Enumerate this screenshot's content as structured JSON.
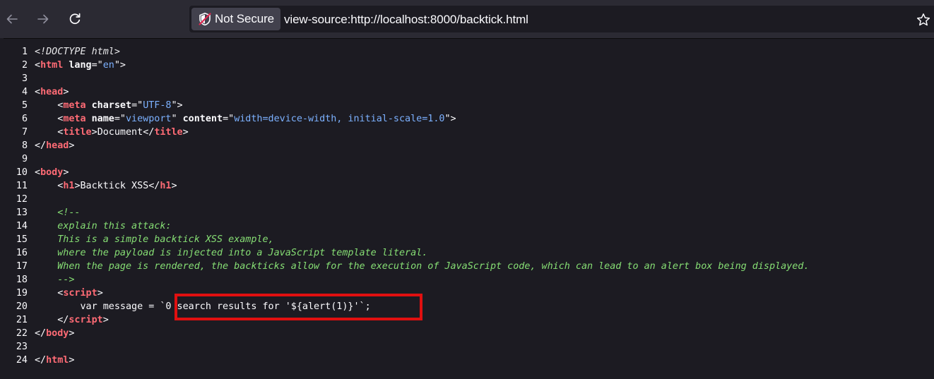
{
  "browser": {
    "security_label": "Not Secure",
    "url": "view-source:http://localhost:8000/backtick.html"
  },
  "icons": {
    "back": "back-arrow-icon",
    "forward": "forward-arrow-icon",
    "reload": "reload-icon",
    "security": "shield-warning-icon",
    "bookmark": "star-icon"
  },
  "colors": {
    "tag": "#ff6b75",
    "attribute_value": "#7cb1ff",
    "comment": "#86de74",
    "highlight_box": "#e01010"
  },
  "source": {
    "line_numbers": [
      "1",
      "2",
      "3",
      "4",
      "5",
      "6",
      "7",
      "8",
      "9",
      "10",
      "11",
      "12",
      "13",
      "14",
      "15",
      "16",
      "17",
      "18",
      "19",
      "20",
      "21",
      "22",
      "23",
      "24"
    ],
    "l1": "<!DOCTYPE html>",
    "l2": {
      "lt": "<",
      "tag": "html",
      "attr": "lang",
      "eq": "=\"",
      "val": "en",
      "end": "\">"
    },
    "l4": {
      "lt": "<",
      "tag": "head",
      "gt": ">"
    },
    "l5": {
      "lt": "<",
      "tag": "meta",
      "attr": "charset",
      "eq": "=\"",
      "val": "UTF-8",
      "end": "\">"
    },
    "l6": {
      "lt": "<",
      "tag": "meta",
      "attr1": "name",
      "eq1": "=\"",
      "val1": "viewport",
      "q1": "\" ",
      "attr2": "content",
      "eq2": "=\"",
      "val2": "width=device-width, initial-scale=1.0",
      "end": "\">"
    },
    "l7": {
      "lt": "<",
      "tag": "title",
      "gt": ">",
      "text": "Document",
      "clt": "</",
      "ctag": "title",
      "cgt": ">"
    },
    "l8": {
      "clt": "</",
      "ctag": "head",
      "cgt": ">"
    },
    "l10": {
      "lt": "<",
      "tag": "body",
      "gt": ">"
    },
    "l11": {
      "lt": "<",
      "tag": "h1",
      "gt": ">",
      "text": "Backtick XSS",
      "clt": "</",
      "ctag": "h1",
      "cgt": ">"
    },
    "l13": "<!--",
    "l14": "explain this attack:",
    "l15": "This is a simple backtick XSS example,",
    "l16": "where the payload is injected into a JavaScript template literal.",
    "l17": "When the page is rendered, the backticks allow for the execution of JavaScript code, which can lead to an alert box being displayed.",
    "l18": "-->",
    "l19": {
      "lt": "<",
      "tag": "script",
      "gt": ">"
    },
    "l20": "var message = `0 search results for '${alert(1)}'`;",
    "l21": {
      "clt": "</",
      "ctag": "script",
      "cgt": ">"
    },
    "l22": {
      "clt": "</",
      "ctag": "body",
      "cgt": ">"
    },
    "l24": {
      "clt": "</",
      "ctag": "html",
      "cgt": ">"
    }
  }
}
